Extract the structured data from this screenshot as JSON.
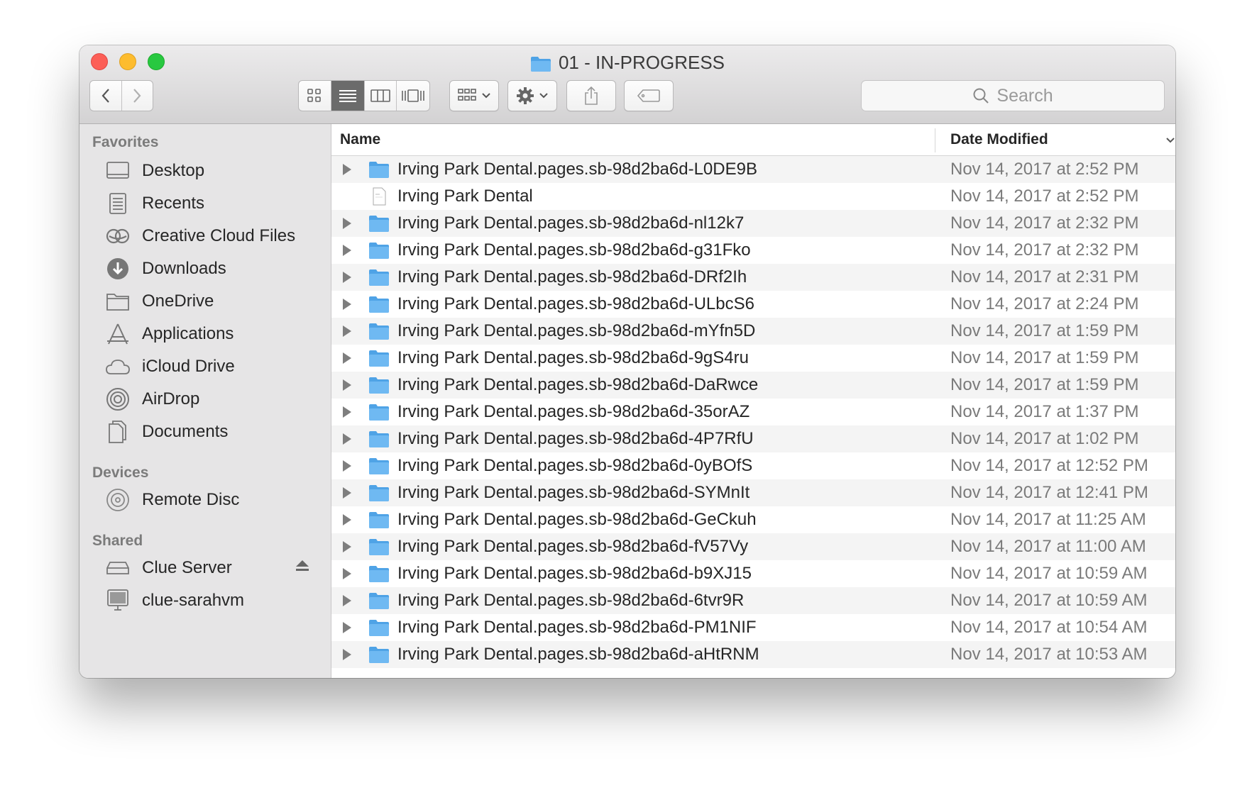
{
  "window": {
    "title": "01 - IN-PROGRESS"
  },
  "toolbar": {
    "view_modes": [
      "icon-view",
      "list-view",
      "column-view",
      "cover-flow-view"
    ],
    "active_view": "list-view"
  },
  "search": {
    "placeholder": "Search"
  },
  "sidebar": {
    "favorites_heading": "Favorites",
    "favorites": [
      {
        "label": "Desktop",
        "icon": "desktop-icon"
      },
      {
        "label": "Recents",
        "icon": "recents-icon"
      },
      {
        "label": "Creative Cloud Files",
        "icon": "creative-cloud-icon"
      },
      {
        "label": "Downloads",
        "icon": "downloads-icon"
      },
      {
        "label": "OneDrive",
        "icon": "folder-icon"
      },
      {
        "label": "Applications",
        "icon": "applications-icon"
      },
      {
        "label": "iCloud Drive",
        "icon": "cloud-icon"
      },
      {
        "label": "AirDrop",
        "icon": "airdrop-icon"
      },
      {
        "label": "Documents",
        "icon": "documents-icon"
      }
    ],
    "devices_heading": "Devices",
    "devices": [
      {
        "label": "Remote Disc",
        "icon": "disc-icon"
      }
    ],
    "shared_heading": "Shared",
    "shared": [
      {
        "label": "Clue Server",
        "icon": "server-icon",
        "ejectable": true
      },
      {
        "label": "clue-sarahvm",
        "icon": "computer-icon"
      }
    ]
  },
  "list": {
    "columns": {
      "name": "Name",
      "date": "Date Modified"
    },
    "rows": [
      {
        "name": "Irving Park Dental.pages.sb-98d2ba6d-L0DE9B",
        "date": "Nov 14, 2017 at 2:52 PM",
        "type": "folder"
      },
      {
        "name": "Irving Park Dental",
        "date": "Nov 14, 2017 at 2:52 PM",
        "type": "document"
      },
      {
        "name": "Irving Park Dental.pages.sb-98d2ba6d-nl12k7",
        "date": "Nov 14, 2017 at 2:32 PM",
        "type": "folder"
      },
      {
        "name": "Irving Park Dental.pages.sb-98d2ba6d-g31Fko",
        "date": "Nov 14, 2017 at 2:32 PM",
        "type": "folder"
      },
      {
        "name": "Irving Park Dental.pages.sb-98d2ba6d-DRf2Ih",
        "date": "Nov 14, 2017 at 2:31 PM",
        "type": "folder"
      },
      {
        "name": "Irving Park Dental.pages.sb-98d2ba6d-ULbcS6",
        "date": "Nov 14, 2017 at 2:24 PM",
        "type": "folder"
      },
      {
        "name": "Irving Park Dental.pages.sb-98d2ba6d-mYfn5D",
        "date": "Nov 14, 2017 at 1:59 PM",
        "type": "folder"
      },
      {
        "name": "Irving Park Dental.pages.sb-98d2ba6d-9gS4ru",
        "date": "Nov 14, 2017 at 1:59 PM",
        "type": "folder"
      },
      {
        "name": "Irving Park Dental.pages.sb-98d2ba6d-DaRwce",
        "date": "Nov 14, 2017 at 1:59 PM",
        "type": "folder"
      },
      {
        "name": "Irving Park Dental.pages.sb-98d2ba6d-35orAZ",
        "date": "Nov 14, 2017 at 1:37 PM",
        "type": "folder"
      },
      {
        "name": "Irving Park Dental.pages.sb-98d2ba6d-4P7RfU",
        "date": "Nov 14, 2017 at 1:02 PM",
        "type": "folder"
      },
      {
        "name": "Irving Park Dental.pages.sb-98d2ba6d-0yBOfS",
        "date": "Nov 14, 2017 at 12:52 PM",
        "type": "folder"
      },
      {
        "name": "Irving Park Dental.pages.sb-98d2ba6d-SYMnIt",
        "date": "Nov 14, 2017 at 12:41 PM",
        "type": "folder"
      },
      {
        "name": "Irving Park Dental.pages.sb-98d2ba6d-GeCkuh",
        "date": "Nov 14, 2017 at 11:25 AM",
        "type": "folder"
      },
      {
        "name": "Irving Park Dental.pages.sb-98d2ba6d-fV57Vy",
        "date": "Nov 14, 2017 at 11:00 AM",
        "type": "folder"
      },
      {
        "name": "Irving Park Dental.pages.sb-98d2ba6d-b9XJ15",
        "date": "Nov 14, 2017 at 10:59 AM",
        "type": "folder"
      },
      {
        "name": "Irving Park Dental.pages.sb-98d2ba6d-6tvr9R",
        "date": "Nov 14, 2017 at 10:59 AM",
        "type": "folder"
      },
      {
        "name": "Irving Park Dental.pages.sb-98d2ba6d-PM1NIF",
        "date": "Nov 14, 2017 at 10:54 AM",
        "type": "folder"
      },
      {
        "name": "Irving Park Dental.pages.sb-98d2ba6d-aHtRNM",
        "date": "Nov 14, 2017 at 10:53 AM",
        "type": "folder"
      }
    ]
  },
  "colors": {
    "folder_blue": "#6fb9f2",
    "folder_blue_dark": "#4fa3e6",
    "selected_segment": "#6b6b6b"
  }
}
